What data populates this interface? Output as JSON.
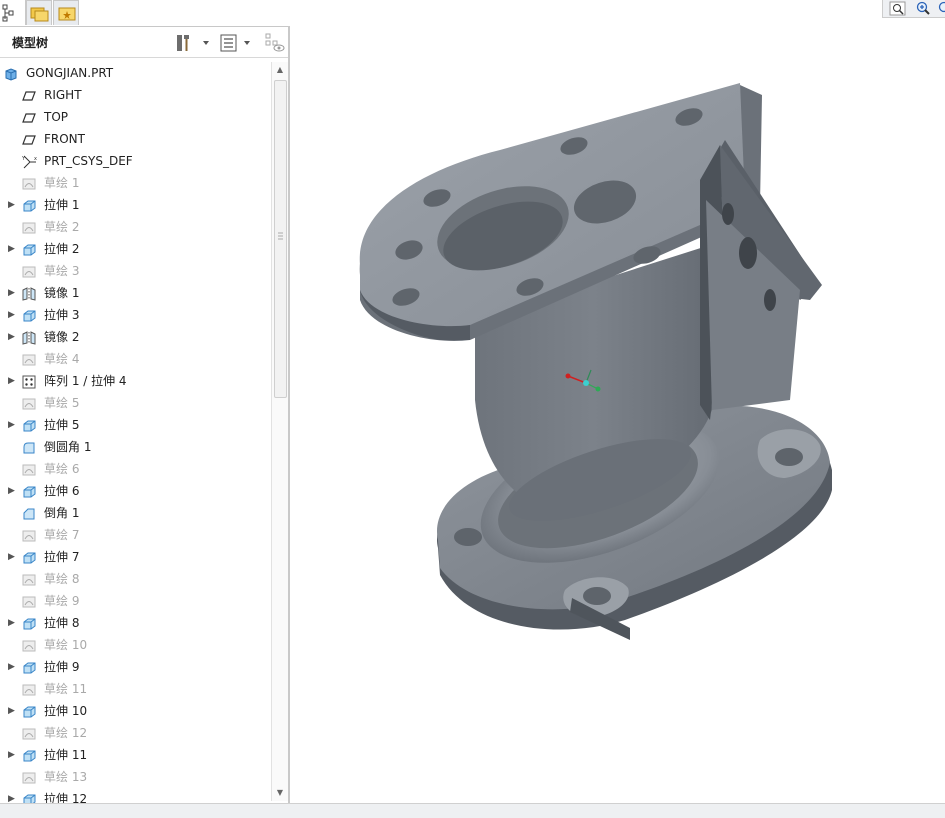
{
  "panel": {
    "title": "模型树"
  },
  "tree": {
    "items": [
      {
        "label": "GONGJIAN.PRT",
        "icon": "part-icon",
        "expandable": false,
        "dim": false,
        "indent": 0
      },
      {
        "label": "RIGHT",
        "icon": "datum-plane-icon",
        "expandable": false,
        "dim": false,
        "indent": 1
      },
      {
        "label": "TOP",
        "icon": "datum-plane-icon",
        "expandable": false,
        "dim": false,
        "indent": 1
      },
      {
        "label": "FRONT",
        "icon": "datum-plane-icon",
        "expandable": false,
        "dim": false,
        "indent": 1
      },
      {
        "label": "PRT_CSYS_DEF",
        "icon": "coordinate-system-icon",
        "expandable": false,
        "dim": false,
        "indent": 1
      },
      {
        "label": "草绘 1",
        "icon": "sketch-icon",
        "expandable": false,
        "dim": true,
        "indent": 1
      },
      {
        "label": "拉伸 1",
        "icon": "extrude-icon",
        "expandable": true,
        "dim": false,
        "indent": 1
      },
      {
        "label": "草绘 2",
        "icon": "sketch-icon",
        "expandable": false,
        "dim": true,
        "indent": 1
      },
      {
        "label": "拉伸 2",
        "icon": "extrude-icon",
        "expandable": true,
        "dim": false,
        "indent": 1
      },
      {
        "label": "草绘 3",
        "icon": "sketch-icon",
        "expandable": false,
        "dim": true,
        "indent": 1
      },
      {
        "label": "镜像 1",
        "icon": "mirror-icon",
        "expandable": true,
        "dim": false,
        "indent": 1
      },
      {
        "label": "拉伸 3",
        "icon": "extrude-icon",
        "expandable": true,
        "dim": false,
        "indent": 1
      },
      {
        "label": "镜像 2",
        "icon": "mirror-icon",
        "expandable": true,
        "dim": false,
        "indent": 1
      },
      {
        "label": "草绘 4",
        "icon": "sketch-icon",
        "expandable": false,
        "dim": true,
        "indent": 1
      },
      {
        "label": "阵列 1 / 拉伸 4",
        "icon": "pattern-icon",
        "expandable": true,
        "dim": false,
        "indent": 1
      },
      {
        "label": "草绘 5",
        "icon": "sketch-icon",
        "expandable": false,
        "dim": true,
        "indent": 1
      },
      {
        "label": "拉伸 5",
        "icon": "extrude-icon",
        "expandable": true,
        "dim": false,
        "indent": 1
      },
      {
        "label": "倒圆角 1",
        "icon": "round-icon",
        "expandable": false,
        "dim": false,
        "indent": 1
      },
      {
        "label": "草绘 6",
        "icon": "sketch-icon",
        "expandable": false,
        "dim": true,
        "indent": 1
      },
      {
        "label": "拉伸 6",
        "icon": "extrude-icon",
        "expandable": true,
        "dim": false,
        "indent": 1
      },
      {
        "label": "倒角 1",
        "icon": "chamfer-icon",
        "expandable": false,
        "dim": false,
        "indent": 1
      },
      {
        "label": "草绘 7",
        "icon": "sketch-icon",
        "expandable": false,
        "dim": true,
        "indent": 1
      },
      {
        "label": "拉伸 7",
        "icon": "extrude-icon",
        "expandable": true,
        "dim": false,
        "indent": 1
      },
      {
        "label": "草绘 8",
        "icon": "sketch-icon",
        "expandable": false,
        "dim": true,
        "indent": 1
      },
      {
        "label": "草绘 9",
        "icon": "sketch-icon",
        "expandable": false,
        "dim": true,
        "indent": 1
      },
      {
        "label": "拉伸 8",
        "icon": "extrude-icon",
        "expandable": true,
        "dim": false,
        "indent": 1
      },
      {
        "label": "草绘 10",
        "icon": "sketch-icon",
        "expandable": false,
        "dim": true,
        "indent": 1
      },
      {
        "label": "拉伸 9",
        "icon": "extrude-icon",
        "expandable": true,
        "dim": false,
        "indent": 1
      },
      {
        "label": "草绘 11",
        "icon": "sketch-icon",
        "expandable": false,
        "dim": true,
        "indent": 1
      },
      {
        "label": "拉伸 10",
        "icon": "extrude-icon",
        "expandable": true,
        "dim": false,
        "indent": 1
      },
      {
        "label": "草绘 12",
        "icon": "sketch-icon",
        "expandable": false,
        "dim": true,
        "indent": 1
      },
      {
        "label": "拉伸 11",
        "icon": "extrude-icon",
        "expandable": true,
        "dim": false,
        "indent": 1
      },
      {
        "label": "草绘 13",
        "icon": "sketch-icon",
        "expandable": false,
        "dim": true,
        "indent": 1
      },
      {
        "label": "拉伸 12",
        "icon": "extrude-icon",
        "expandable": true,
        "dim": false,
        "indent": 1
      }
    ]
  },
  "colors": {
    "model_face": "#8a9099",
    "model_dark": "#5f656d",
    "model_light": "#b4b9bf",
    "accent": "#1a73c8"
  }
}
